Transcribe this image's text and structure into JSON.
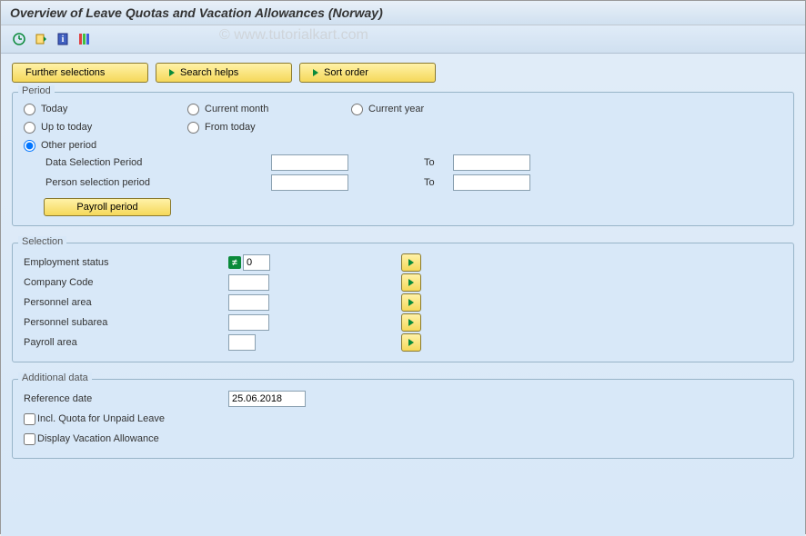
{
  "title": "Overview of Leave Quotas and Vacation Allowances (Norway)",
  "watermark": "© www.tutorialkart.com",
  "toolbar_buttons": {
    "further_selections": "Further selections",
    "search_helps": "Search helps",
    "sort_order": "Sort order"
  },
  "period": {
    "legend": "Period",
    "today": "Today",
    "current_month": "Current month",
    "current_year": "Current year",
    "up_to_today": "Up to today",
    "from_today": "From today",
    "other_period": "Other period",
    "selected": "other_period",
    "data_selection_label": "Data Selection Period",
    "data_selection_from": "",
    "data_selection_to": "",
    "person_selection_label": "Person selection period",
    "person_selection_from": "",
    "person_selection_to": "",
    "to_label": "To",
    "payroll_period_btn": "Payroll period"
  },
  "selection": {
    "legend": "Selection",
    "employment_status_label": "Employment status",
    "employment_status_value": "0",
    "company_code_label": "Company Code",
    "company_code_value": "",
    "personnel_area_label": "Personnel area",
    "personnel_area_value": "",
    "personnel_subarea_label": "Personnel subarea",
    "personnel_subarea_value": "",
    "payroll_area_label": "Payroll area",
    "payroll_area_value": ""
  },
  "additional": {
    "legend": "Additional data",
    "reference_date_label": "Reference date",
    "reference_date_value": "25.06.2018",
    "incl_quota_label": "Incl. Quota for Unpaid Leave",
    "display_vac_label": "Display Vacation Allowance"
  }
}
